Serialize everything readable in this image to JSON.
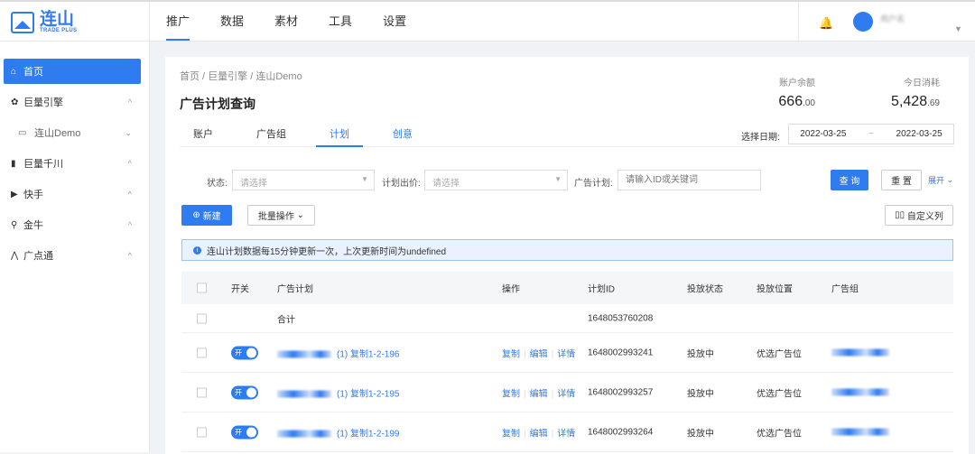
{
  "app": {
    "logo_text": "连山",
    "logo_sub": "TRADE PLUS",
    "user_name": "用户名"
  },
  "nav": [
    "推广",
    "数据",
    "素材",
    "工具",
    "设置"
  ],
  "sidebar": [
    {
      "label": "首页",
      "icon": "home-icon"
    },
    {
      "label": "巨量引擎",
      "icon": "gear-icon"
    },
    {
      "label": "连山Demo",
      "icon": "monitor-icon"
    },
    {
      "label": "巨量千川",
      "icon": "chart-icon"
    },
    {
      "label": "快手",
      "icon": "kuaishou-icon"
    },
    {
      "label": "金牛",
      "icon": "network-icon"
    },
    {
      "label": "广点通",
      "icon": "gdt-icon"
    }
  ],
  "breadcrumb": [
    "首页",
    "巨量引擎",
    "连山Demo"
  ],
  "page_title": "广告计划查询",
  "stats": {
    "balance_label": "账户余额",
    "balance_int": "666",
    "balance_dec": ".00",
    "spend_label": "今日消耗",
    "spend_int": "5,428",
    "spend_dec": ".69"
  },
  "tabs": [
    "账户",
    "广告组",
    "计划",
    "创意"
  ],
  "date": {
    "label": "选择日期:",
    "start": "2022-03-25",
    "sep": "~",
    "end": "2022-03-25"
  },
  "filters": {
    "status_label": "状态:",
    "status_placeholder": "请选择",
    "bid_label": "计划出价:",
    "bid_placeholder": "请选择",
    "plan_label": "广告计划:",
    "plan_placeholder": "请输入ID或关键词",
    "query": "查 询",
    "reset": "重 置",
    "expand": "展开"
  },
  "toolbar": {
    "new": "新建",
    "batch": "批量操作",
    "custom_cols": "自定义列"
  },
  "notice": "连山计划数据每15分钟更新一次，上次更新时间为undefined",
  "table": {
    "headers": [
      "开关",
      "广告计划",
      "操作",
      "计划ID",
      "投放状态",
      "投放位置",
      "广告组"
    ],
    "summary": {
      "label": "合计",
      "id": "1648053760208"
    },
    "toggle_label": "开",
    "ops": [
      "复制",
      "编辑",
      "详情"
    ],
    "rows": [
      {
        "name": "(1) 复制1-2-196",
        "id": "1648002993241",
        "status": "投放中",
        "position": "优选广告位"
      },
      {
        "name": "(1) 复制1-2-195",
        "id": "1648002993257",
        "status": "投放中",
        "position": "优选广告位"
      },
      {
        "name": "(1) 复制1-2-199",
        "id": "1648002993264",
        "status": "投放中",
        "position": "优选广告位"
      }
    ]
  }
}
